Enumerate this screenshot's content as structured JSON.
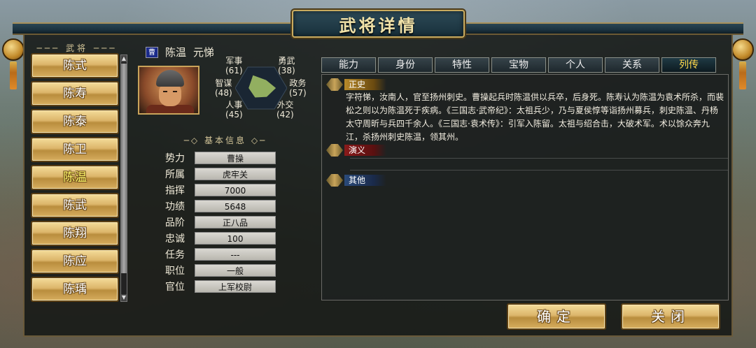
{
  "window": {
    "title": "武将详情"
  },
  "list": {
    "header": "武将",
    "items": [
      {
        "label": "陈式",
        "selected": false
      },
      {
        "label": "陈寿",
        "selected": false
      },
      {
        "label": "陈泰",
        "selected": false
      },
      {
        "label": "陈卫",
        "selected": false
      },
      {
        "label": "陈温",
        "selected": true
      },
      {
        "label": "陈武",
        "selected": false
      },
      {
        "label": "陈翔",
        "selected": false
      },
      {
        "label": "陈应",
        "selected": false
      },
      {
        "label": "陈瑀",
        "selected": false
      }
    ]
  },
  "general": {
    "faction_badge": "曹",
    "name": "陈温",
    "courtesy": "元悌",
    "portrait_icon": "general-portrait",
    "stats": {
      "military": {
        "label": "军事",
        "value": "(61)"
      },
      "bravery": {
        "label": "勇武",
        "value": "(38)"
      },
      "strategy": {
        "label": "智谋",
        "value": "(48)"
      },
      "politics": {
        "label": "政务",
        "value": "(57)"
      },
      "personnel": {
        "label": "人事",
        "value": "(45)"
      },
      "diplomacy": {
        "label": "外交",
        "value": "(42)"
      }
    },
    "stat_values": [
      61,
      38,
      57,
      42,
      45,
      48
    ]
  },
  "basic_info": {
    "title": "基本信息",
    "rows": [
      {
        "label": "势力",
        "value": "曹操"
      },
      {
        "label": "所属",
        "value": "虎牢关"
      },
      {
        "label": "指挥",
        "value": "7000"
      },
      {
        "label": "功绩",
        "value": "5648"
      },
      {
        "label": "品阶",
        "value": "正八品"
      },
      {
        "label": "忠诚",
        "value": "100"
      },
      {
        "label": "任务",
        "value": "---"
      },
      {
        "label": "职位",
        "value": "一般"
      },
      {
        "label": "官位",
        "value": "上军校尉"
      }
    ]
  },
  "tabs": [
    {
      "label": "能力",
      "active": false
    },
    {
      "label": "身份",
      "active": false
    },
    {
      "label": "特性",
      "active": false
    },
    {
      "label": "宝物",
      "active": false
    },
    {
      "label": "个人",
      "active": false
    },
    {
      "label": "关系",
      "active": false
    },
    {
      "label": "列传",
      "active": true
    }
  ],
  "biography": {
    "zhengshi_label": "正史",
    "yanyi_label": "演义",
    "qita_label": "其他",
    "zhengshi_text": "字符悌，汝南人，官至扬州刺史。曹操起兵时陈温供以兵卒，后身死。陈寿认为陈温为袁术所杀，而裴松之则以为陈温死于疾病。《三国志·武帝纪》：太祖兵少，乃与夏侯惇等诣扬州募兵，刺史陈温、丹杨太守周昕与兵四千余人。《三国志·袁术传》：引军入陈留。太祖与绍合击，大破术军。术以馀众奔九江，杀扬州刺史陈温，领其州。"
  },
  "buttons": {
    "confirm": "确定",
    "close": "关闭"
  },
  "colors": {
    "gold": "#dcb56a",
    "selected_text": "#fff86a",
    "active_tab": "#ffd84a",
    "faction": "#1a2a8a"
  }
}
